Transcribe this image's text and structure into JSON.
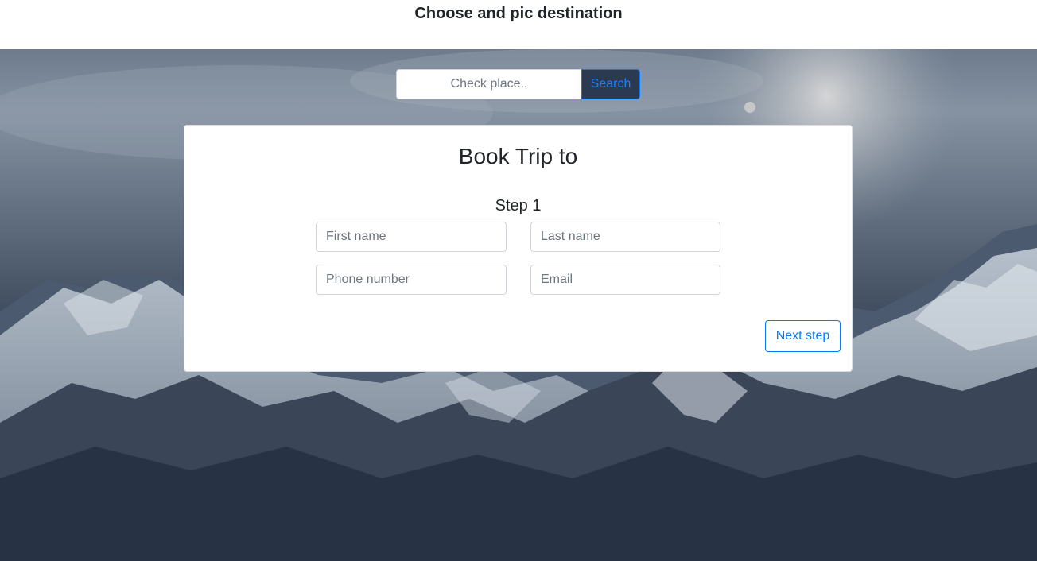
{
  "header": {
    "title": "Choose and pic destination"
  },
  "search": {
    "placeholder": "Check place..",
    "button_label": "Search"
  },
  "booking": {
    "title": "Book Trip to",
    "step": "Step 1",
    "fields": {
      "first_name": {
        "placeholder": "First name"
      },
      "last_name": {
        "placeholder": "Last name"
      },
      "phone": {
        "placeholder": "Phone number"
      },
      "email": {
        "placeholder": "Email"
      }
    },
    "next_label": "Next step"
  },
  "colors": {
    "accent": "#007bff",
    "text": "#212529",
    "border": "#ced4da"
  },
  "background": {
    "image": "snowy-mountains-photo"
  }
}
